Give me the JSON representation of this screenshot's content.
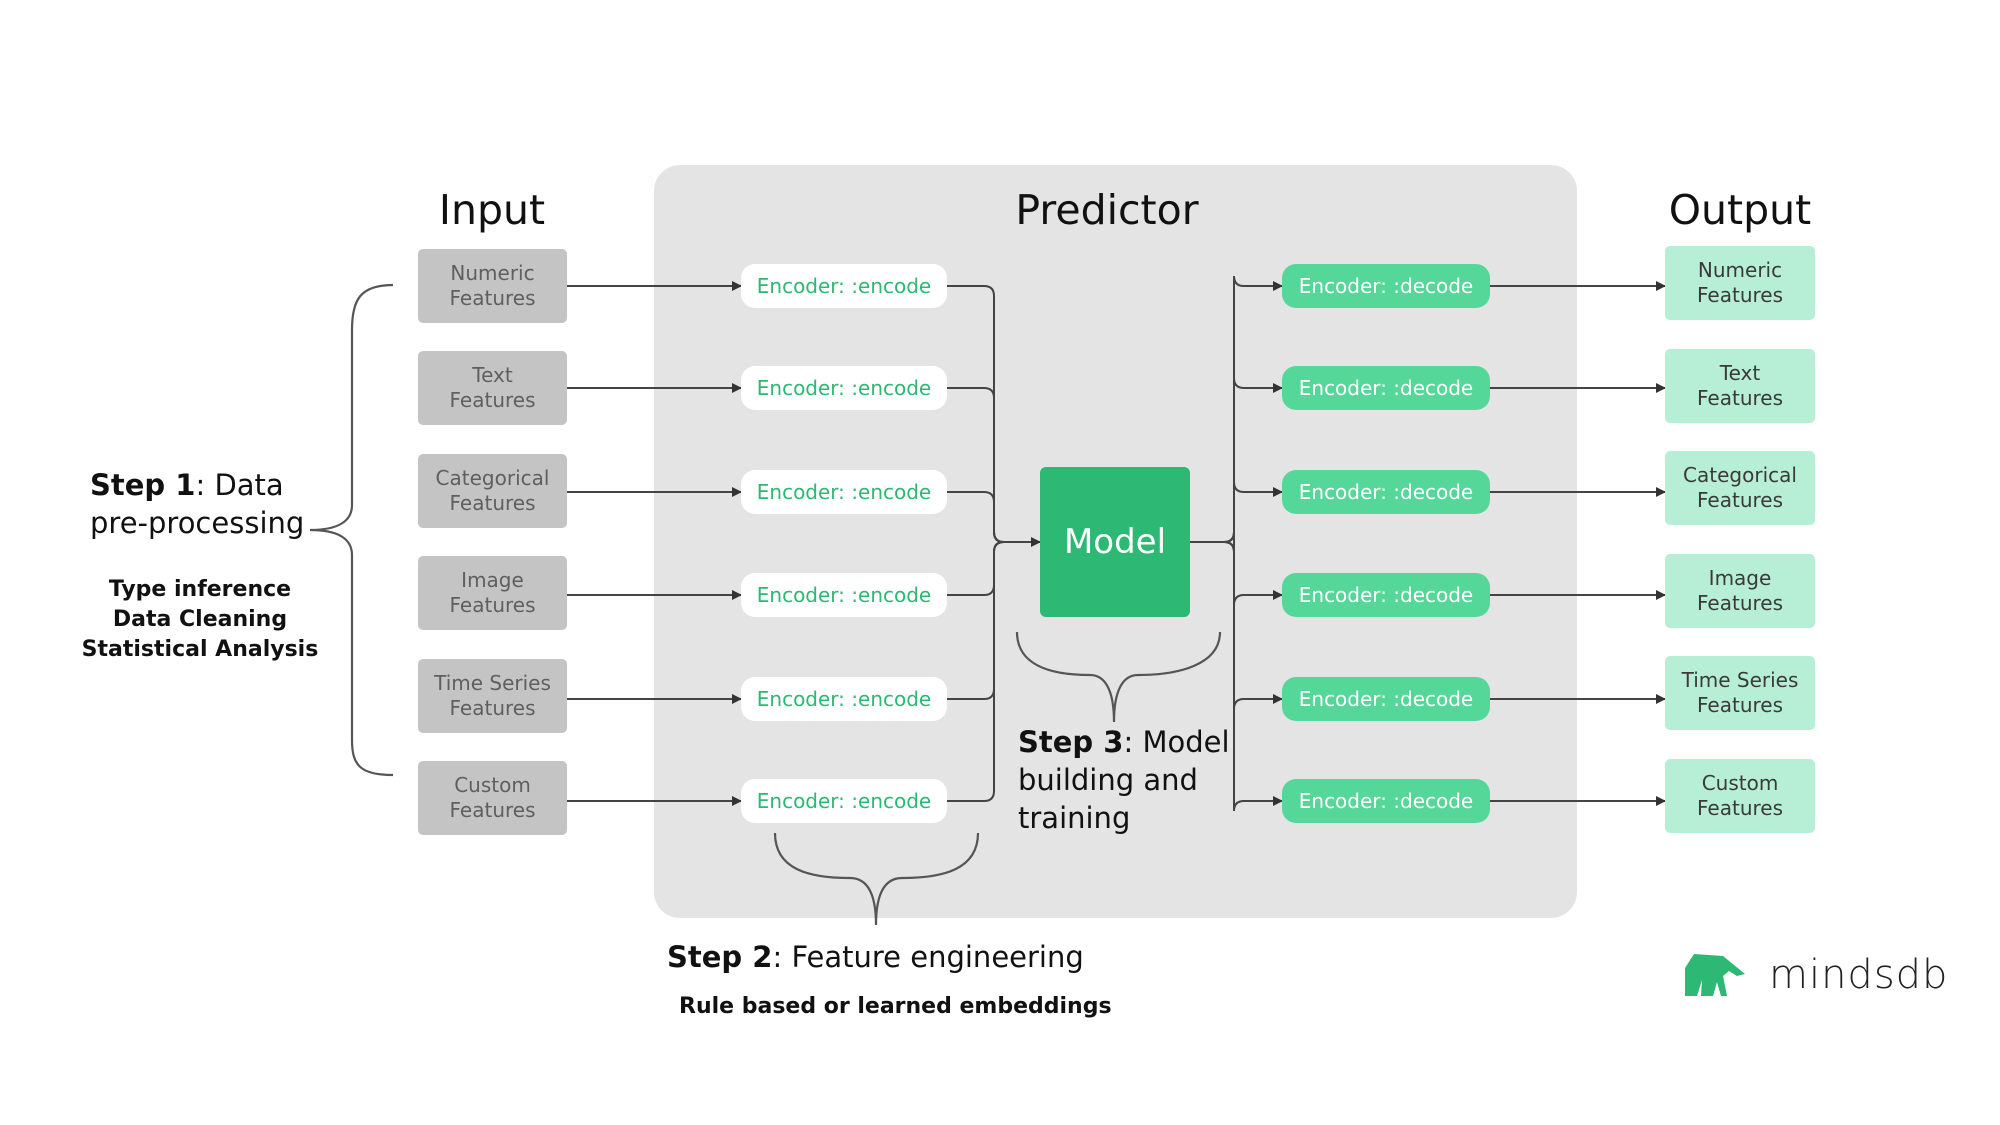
{
  "titles": {
    "input": "Input",
    "predictor": "Predictor",
    "output": "Output"
  },
  "inputs": [
    {
      "line1": "Numeric",
      "line2": "Features"
    },
    {
      "line1": "Text",
      "line2": "Features"
    },
    {
      "line1": "Categorical",
      "line2": "Features"
    },
    {
      "line1": "Image",
      "line2": "Features"
    },
    {
      "line1": "Time Series",
      "line2": "Features"
    },
    {
      "line1": "Custom",
      "line2": "Features"
    }
  ],
  "encoders": [
    "Encoder: :encode",
    "Encoder: :encode",
    "Encoder: :encode",
    "Encoder: :encode",
    "Encoder: :encode",
    "Encoder: :encode"
  ],
  "model": "Model",
  "decoders": [
    "Encoder: :decode",
    "Encoder: :decode",
    "Encoder: :decode",
    "Encoder: :decode",
    "Encoder: :decode",
    "Encoder: :decode"
  ],
  "outputs": [
    {
      "line1": "Numeric",
      "line2": "Features"
    },
    {
      "line1": "Text",
      "line2": "Features"
    },
    {
      "line1": "Categorical",
      "line2": "Features"
    },
    {
      "line1": "Image",
      "line2": "Features"
    },
    {
      "line1": "Time Series",
      "line2": "Features"
    },
    {
      "line1": "Custom",
      "line2": "Features"
    }
  ],
  "step1": {
    "bold": "Step 1",
    "rest": ": Data",
    "line2": "pre-processing",
    "details": [
      "Type inference",
      "Data Cleaning",
      "Statistical Analysis"
    ]
  },
  "step2": {
    "bold": "Step 2",
    "rest": ": Feature engineering",
    "detail": "Rule based or learned embeddings"
  },
  "step3": {
    "bold": "Step 3",
    "rest": ": Model",
    "line2": "building and",
    "line3": "training"
  },
  "logo": {
    "text": "mindsdb"
  },
  "colors": {
    "green": "#2db873",
    "light_green": "#55d79a",
    "pale_green": "#b7efd6",
    "gray_box": "#c4c4c4",
    "panel": "#e4e4e4"
  }
}
